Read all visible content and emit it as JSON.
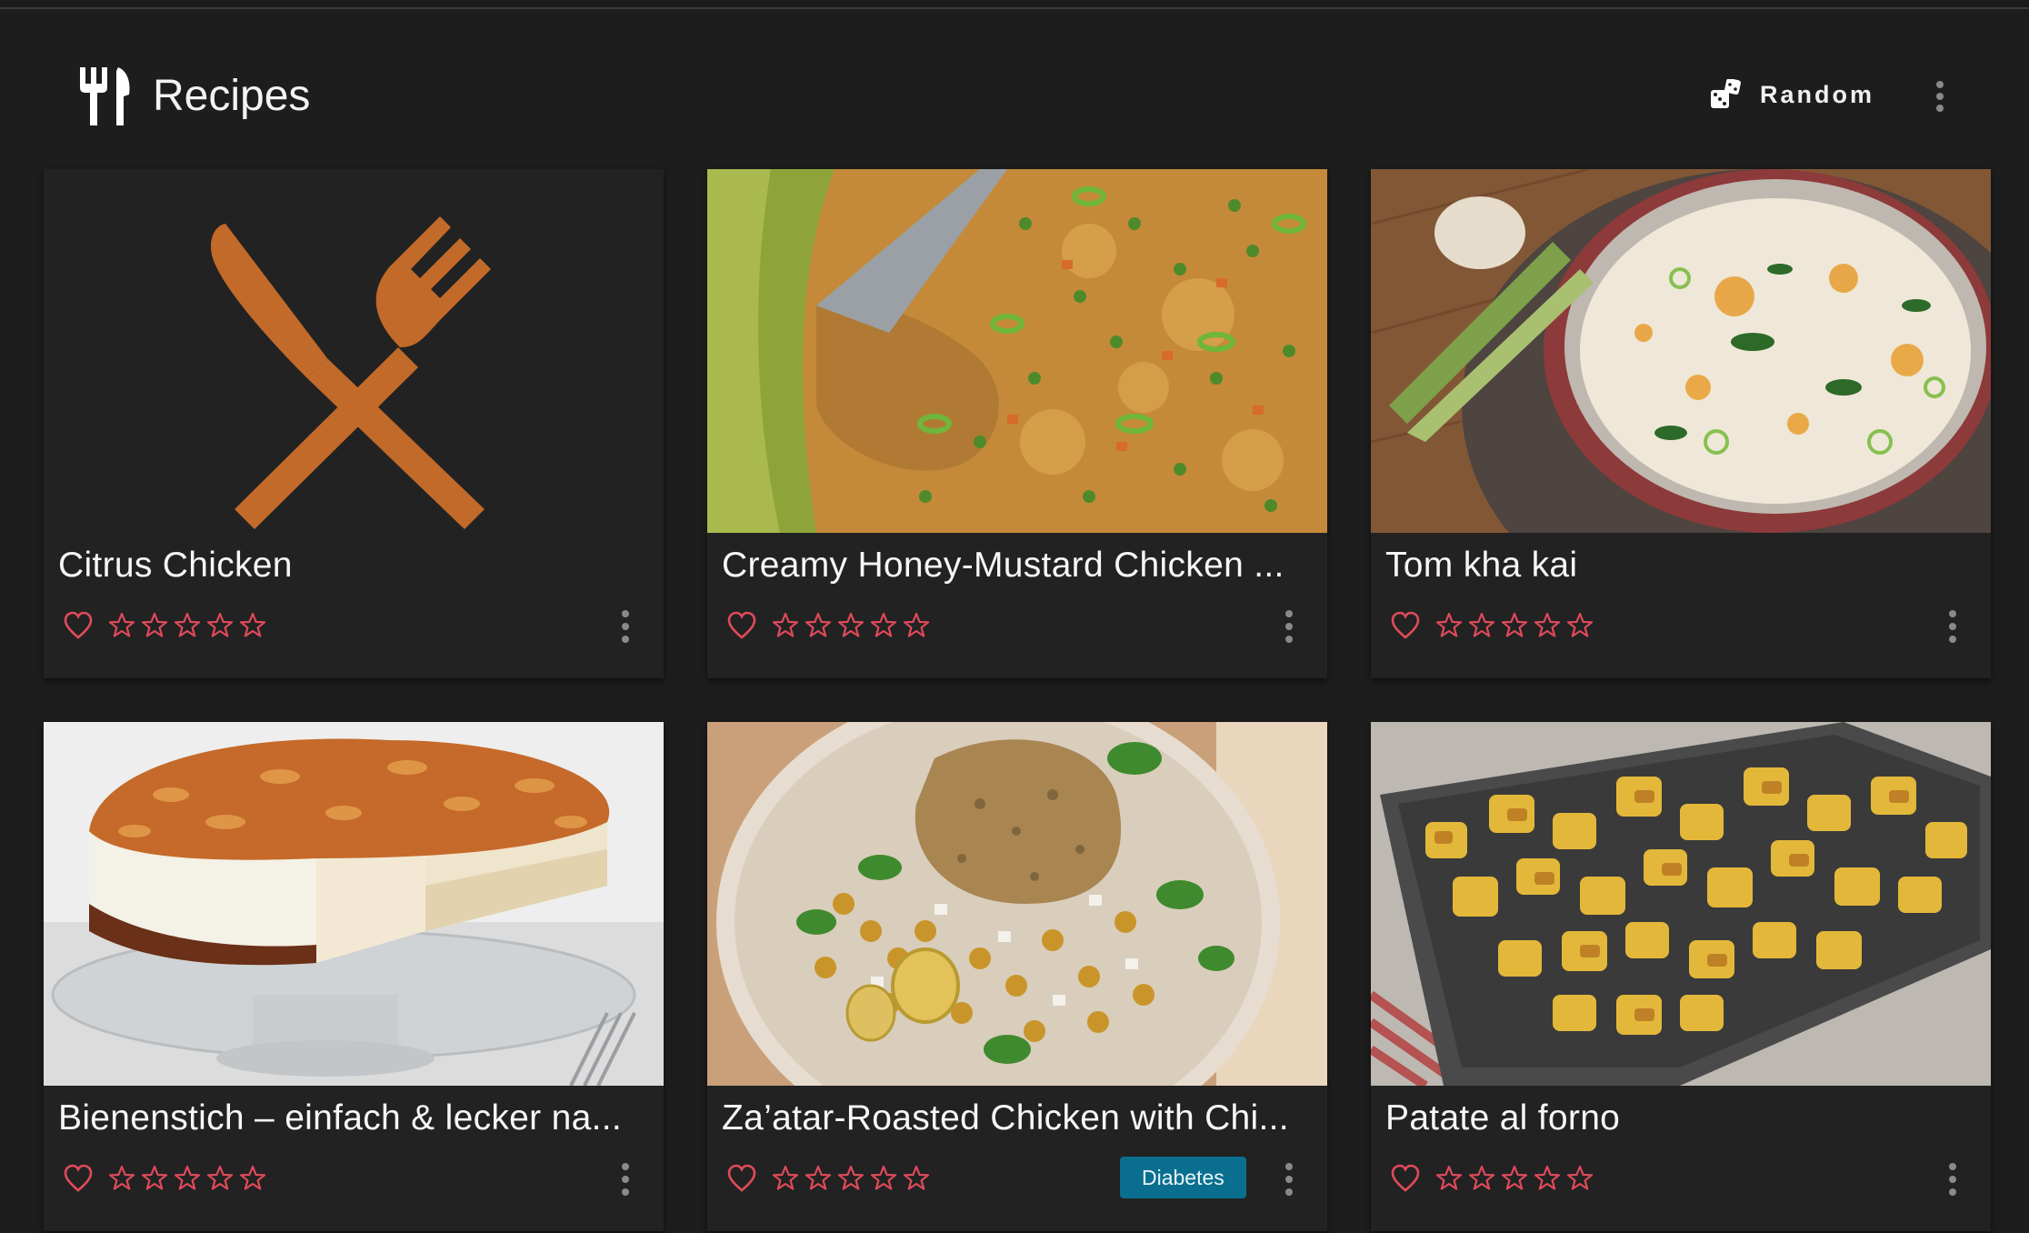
{
  "header": {
    "title": "Recipes",
    "logo_icon": "silverware-fork-knife-icon",
    "random_label": "Random",
    "random_icon": "dice-icon",
    "menu_icon": "more-vertical-icon"
  },
  "colors": {
    "background": "#1d1d1d",
    "card": "#222222",
    "accent": "#c26a2a",
    "rating": "#e04a5a",
    "tag": "#0a6f8e"
  },
  "recipes": [
    {
      "title": "Citrus Chicken",
      "image": "placeholder-fork-knife",
      "rating": 0,
      "favorite": false,
      "tags": []
    },
    {
      "title": "Creamy Honey-Mustard Chicken with Peas",
      "display_title": "Creamy Honey-Mustard Chicken ...",
      "image": "chicken-peas-casserole",
      "rating": 0,
      "favorite": false,
      "tags": []
    },
    {
      "title": "Tom kha kai",
      "image": "coconut-soup-bowl",
      "rating": 0,
      "favorite": false,
      "tags": []
    },
    {
      "title": "Bienenstich – einfach & lecker na...",
      "image": "bee-sting-cake",
      "rating": 0,
      "favorite": false,
      "tags": []
    },
    {
      "title": "Za’atar-Roasted Chicken with Chi...",
      "image": "zaatar-chicken-chickpeas",
      "rating": 0,
      "favorite": false,
      "tags": [
        "Diabetes"
      ]
    },
    {
      "title": "Patate al forno",
      "image": "roasted-potatoes-tray",
      "rating": 0,
      "favorite": false,
      "tags": []
    }
  ]
}
